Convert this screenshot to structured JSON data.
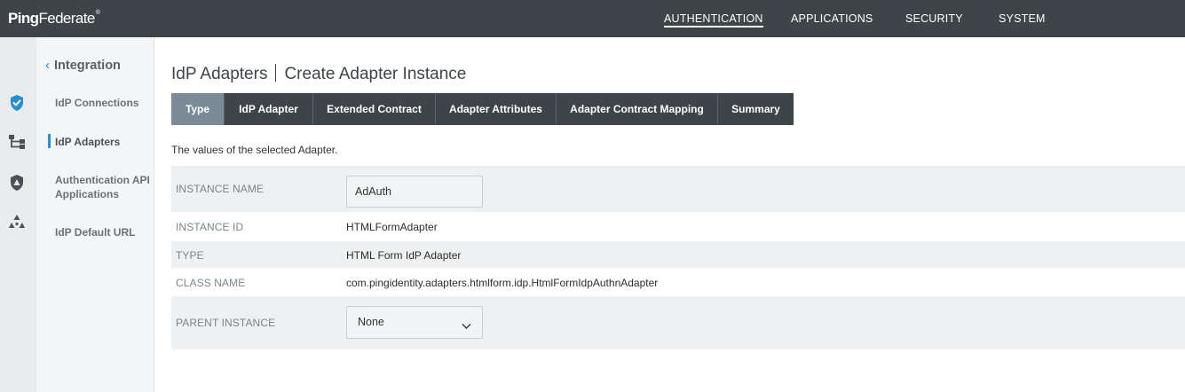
{
  "app": {
    "logo_bold": "Ping",
    "logo_light": "Federate",
    "logo_mark": "®"
  },
  "nav": {
    "items": [
      {
        "label": "AUTHENTICATION",
        "active": true
      },
      {
        "label": "APPLICATIONS",
        "active": false
      },
      {
        "label": "SECURITY",
        "active": false
      },
      {
        "label": "SYSTEM",
        "active": false
      }
    ]
  },
  "rail": {
    "icons": [
      "shield-check-icon",
      "hierarchy-icon",
      "shield-person-icon",
      "recycle-icon"
    ]
  },
  "sidebar": {
    "back_label": "Integration",
    "items": [
      {
        "label": "IdP Connections"
      },
      {
        "label": "IdP Adapters",
        "active": true
      },
      {
        "label": "Authentication API Applications"
      },
      {
        "label": "IdP Default URL"
      }
    ]
  },
  "page": {
    "title_main": "IdP Adapters",
    "title_sub": "Create Adapter Instance",
    "description": "The values of the selected Adapter."
  },
  "steps": [
    {
      "label": "Type",
      "active": true
    },
    {
      "label": "IdP Adapter"
    },
    {
      "label": "Extended Contract"
    },
    {
      "label": "Adapter Attributes"
    },
    {
      "label": "Adapter Contract Mapping"
    },
    {
      "label": "Summary"
    }
  ],
  "form": {
    "instance_name": {
      "label": "INSTANCE NAME",
      "value": "AdAuth"
    },
    "instance_id": {
      "label": "INSTANCE ID",
      "value": "HTMLFormAdapter"
    },
    "type": {
      "label": "TYPE",
      "value": "HTML Form IdP Adapter"
    },
    "class_name": {
      "label": "CLASS NAME",
      "value": "com.pingidentity.adapters.htmlform.idp.HtmlFormIdpAuthnAdapter"
    },
    "parent_instance": {
      "label": "PARENT INSTANCE",
      "value": "None"
    }
  },
  "colors": {
    "topbar": "#3d4549",
    "accent": "#2a8dcf",
    "step_active": "#7b8a96",
    "row_shade": "#eef0f1"
  }
}
